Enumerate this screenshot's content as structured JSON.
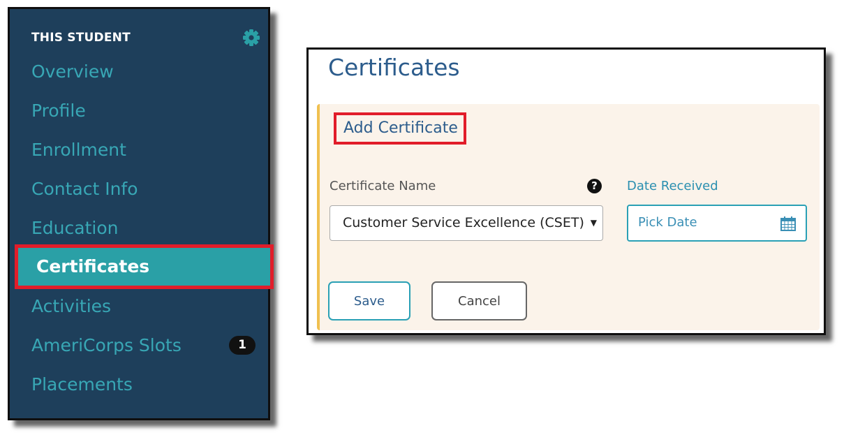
{
  "sidebar": {
    "heading": "THIS STUDENT",
    "items": [
      {
        "label": "Overview"
      },
      {
        "label": "Profile"
      },
      {
        "label": "Enrollment"
      },
      {
        "label": "Contact Info"
      },
      {
        "label": "Education"
      },
      {
        "label": "Certificates"
      },
      {
        "label": "Activities"
      },
      {
        "label": "AmeriCorps Slots",
        "badge": "1"
      },
      {
        "label": "Placements"
      }
    ],
    "active": "Certificates",
    "gear_icon": "gear-icon"
  },
  "certificates": {
    "title": "Certificates",
    "add_heading": "Add Certificate",
    "name_label": "Certificate Name",
    "help_icon": "?",
    "date_label": "Date Received",
    "selected_certificate": "Customer Service Excellence (CSET)",
    "select_arrow": "▼",
    "date_placeholder": "Pick Date",
    "calendar_icon": "calendar-icon",
    "save_label": "Save",
    "cancel_label": "Cancel"
  },
  "colors": {
    "sidebar_bg": "#1e3f5b",
    "nav_text": "#38a7b5",
    "active_bg": "#2aa0a6",
    "highlight_red": "#e11d2a",
    "form_bg": "#fbf3ea",
    "title_blue": "#2c5c8c"
  }
}
